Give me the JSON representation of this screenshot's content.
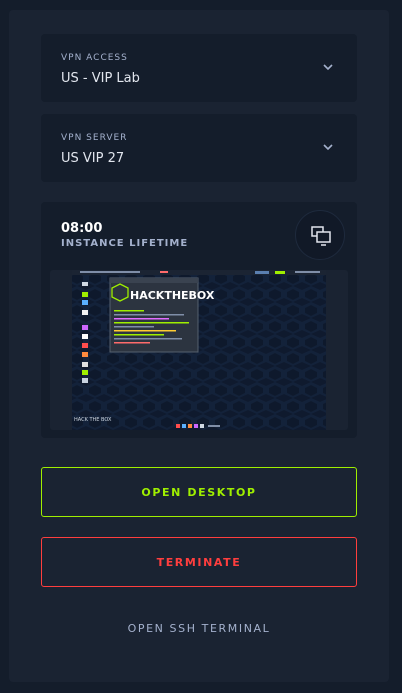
{
  "vpn_access": {
    "label": "VPN ACCESS",
    "value": "US - VIP Lab"
  },
  "vpn_server": {
    "label": "VPN SERVER",
    "value": "US VIP 27"
  },
  "instance": {
    "time": "08:00",
    "lifetime_label": "INSTANCE LIFETIME",
    "preview_logo_text": "HACKTHEBOX",
    "preview_taskbar_text": "HACK THE BOX"
  },
  "actions": {
    "open_desktop": "OPEN DESKTOP",
    "terminate": "TERMINATE",
    "open_ssh": "OPEN SSH TERMINAL"
  },
  "colors": {
    "accent_green": "#9fef00",
    "danger_red": "#ff3e3e",
    "background": "#141d2b",
    "panel": "#1a2332",
    "muted_text": "#a4b1cd"
  },
  "icons": [
    "chevron-down-icon",
    "desktop-icon"
  ]
}
